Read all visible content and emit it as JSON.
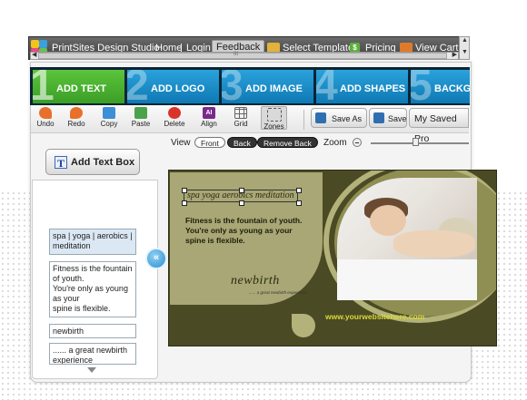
{
  "header": {
    "brand": "PrintSites Design Studio",
    "nav": [
      "Home",
      "Login"
    ],
    "separator": "|",
    "feedback": "Feedback",
    "select_template": "Select Template",
    "pricing": "Pricing",
    "view_cart": "View Cart",
    "scrollbar_grip": "III"
  },
  "tabs": [
    {
      "num": "1",
      "label": "ADD TEXT",
      "color": "#47b531"
    },
    {
      "num": "2",
      "label": "ADD LOGO",
      "color": "#1a8fc9"
    },
    {
      "num": "3",
      "label": "ADD IMAGE",
      "color": "#1a8fc9"
    },
    {
      "num": "4",
      "label": "ADD SHAPES",
      "color": "#1a8fc9"
    },
    {
      "num": "5",
      "label": "BACKGR",
      "color": "#1a8fc9"
    }
  ],
  "toolbar": {
    "undo": "Undo",
    "redo": "Redo",
    "copy": "Copy",
    "paste": "Paste",
    "delete": "Delete",
    "align": "Align",
    "align_icon_text": "AI",
    "grid": "Grid",
    "zones": "Zones",
    "save_as": "Save As",
    "save": "Save",
    "my_saved": "My Saved Pro"
  },
  "view": {
    "label": "View",
    "front": "Front",
    "back": "Back",
    "remove_back": "Remove Back",
    "zoom_label": "Zoom"
  },
  "left_panel": {
    "add_text_box": "Add Text Box",
    "add_text_icon": "T",
    "text_boxes": [
      "spa | yoga | aerobics | meditation",
      "Fitness is the  fountain of youth.\nYou're only as young as your\nspine is flexible.",
      "newbirth",
      "...... a great newbirth experience"
    ]
  },
  "card": {
    "headline": "spa  yoga  aerobics  meditation",
    "body": "Fitness is the  fountain of youth.\nYou're only as young as your\nspine is flexible.",
    "brand": "newbirth",
    "tagline": "...... a great newbirth experience",
    "url": "www.yourwebsitehere.com",
    "colors": {
      "dark": "#4a4a24",
      "light": "#a8a775",
      "url": "#d9d93b"
    }
  },
  "icons": {
    "collapse": "double-chevron-left-icon",
    "scroll": "triangle-down-icon"
  }
}
